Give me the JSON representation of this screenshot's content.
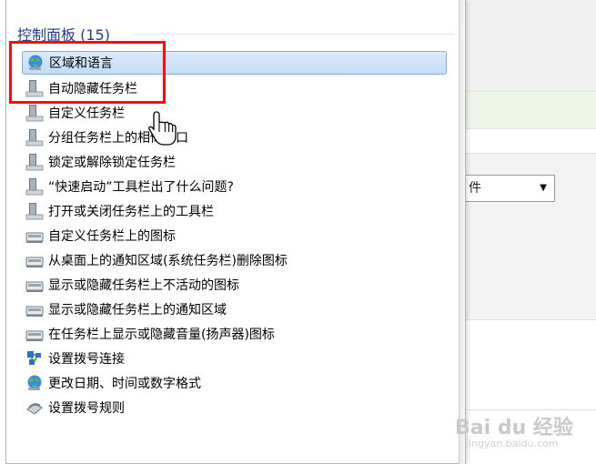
{
  "menu": {
    "header": "控制面板 (15)",
    "items": [
      {
        "label": "区域和语言",
        "icon": "globe-icon",
        "selected": true
      },
      {
        "label": "自动隐藏任务栏",
        "icon": "taskbar-icon"
      },
      {
        "label": "自定义任务栏",
        "icon": "taskbar-icon"
      },
      {
        "label": "分组任务栏上的相似窗口",
        "icon": "taskbar-icon"
      },
      {
        "label": "锁定或解除锁定任务栏",
        "icon": "taskbar-icon"
      },
      {
        "label": "“快速启动”工具栏出了什么问题?",
        "icon": "taskbar-icon"
      },
      {
        "label": "打开或关闭任务栏上的工具栏",
        "icon": "taskbar-icon"
      },
      {
        "label": "自定义任务栏上的图标",
        "icon": "notification-area-icon"
      },
      {
        "label": "从桌面上的通知区域(系统任务栏)删除图标",
        "icon": "notification-area-icon"
      },
      {
        "label": "显示或隐藏任务栏上不活动的图标",
        "icon": "notification-area-icon"
      },
      {
        "label": "显示或隐藏任务栏上的通知区域",
        "icon": "notification-area-icon"
      },
      {
        "label": "在任务栏上显示或隐藏音量(扬声器)图标",
        "icon": "notification-area-icon"
      },
      {
        "label": "设置拨号连接",
        "icon": "network-icon"
      },
      {
        "label": "更改日期、时间或数字格式",
        "icon": "globe-icon"
      },
      {
        "label": "设置拨号规则",
        "icon": "phone-icon"
      }
    ]
  },
  "background": {
    "select_value": "件"
  },
  "watermark": {
    "text": "Bai du 经验",
    "sub": "jingyan.baidu.com"
  },
  "colors": {
    "header": "#1e3f8f",
    "selection": "#c4dcf6",
    "highlight_box": "#ff0a0a"
  }
}
